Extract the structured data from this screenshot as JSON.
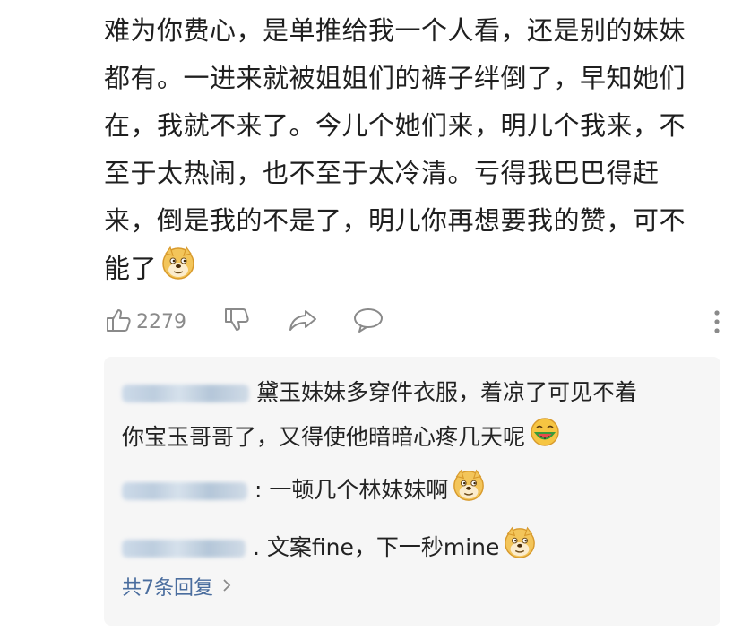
{
  "post": {
    "lines": [
      "难为你费心，是单推给我一个人看，还是别的妹妹",
      "都有。一进来就被姐姐们的裤子绊倒了，早知她们",
      "在，我就不来了。今儿个她们来，明儿个我来，不",
      "至于太热闹，也不至于太冷清。亏得我巴巴得赶",
      "来，倒是我的不是了，明儿你再想要我的赞，可不",
      "能了"
    ],
    "trailing_emoji": "doge-emoji"
  },
  "actions": {
    "like_count": "2279",
    "icons": [
      "thumbs-up-icon",
      "thumbs-down-icon",
      "share-icon",
      "comment-icon",
      "more-vertical-icon"
    ]
  },
  "replies": [
    {
      "name_blurred": true,
      "text_line1": "黛玉妹妹多穿件衣服，着凉了可见不着",
      "text_line2": "你宝玉哥哥了，又得使他暗暗心疼几天呢",
      "emoji": "watermelon-laugh-emoji"
    },
    {
      "name_blurred": true,
      "text": ": 一顿几个林妹妹啊",
      "emoji": "doge-emoji"
    },
    {
      "name_blurred": true,
      "text": ". 文案fine，下一秒mine",
      "emoji": "doge-emoji"
    }
  ],
  "more_replies_label": "共7条回复"
}
